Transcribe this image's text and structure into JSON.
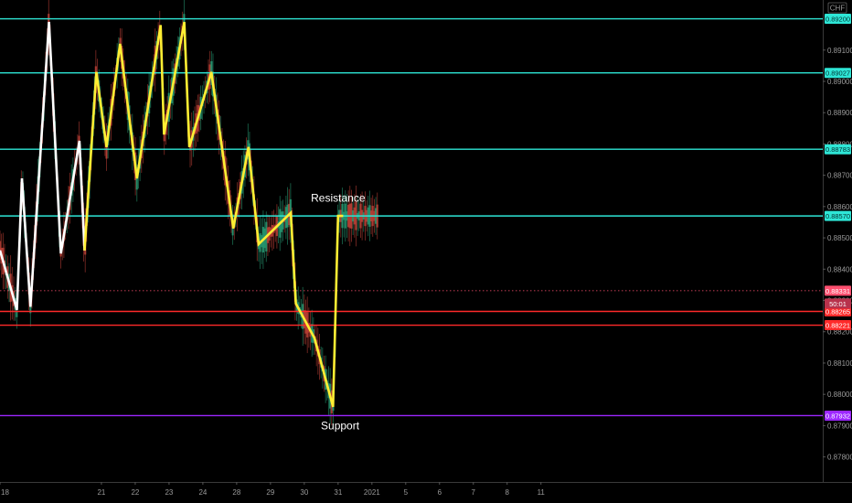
{
  "chart_data": {
    "type": "line",
    "currency": "CHF",
    "y_range": [
      0.8772,
      0.8926
    ],
    "y_ticks": [
      {
        "label": "0.88000",
        "value": 0.88
      },
      {
        "label": "0.88100",
        "value": 0.881
      },
      {
        "label": "0.88200",
        "value": 0.882
      },
      {
        "label": "0.88300",
        "value": 0.883
      },
      {
        "label": "0.88400",
        "value": 0.884
      },
      {
        "label": "0.88500",
        "value": 0.885
      },
      {
        "label": "0.88600",
        "value": 0.886
      },
      {
        "label": "0.88700",
        "value": 0.887
      },
      {
        "label": "0.88800",
        "value": 0.888
      },
      {
        "label": "0.88900",
        "value": 0.889
      },
      {
        "label": "0.89000",
        "value": 0.89
      },
      {
        "label": "0.89100",
        "value": 0.891
      },
      {
        "label": "0.87900",
        "value": 0.879
      },
      {
        "label": "0.87800",
        "value": 0.878
      }
    ],
    "x_range": [
      18,
      43.2
    ],
    "x_ticks": [
      {
        "label": "18",
        "value": 18
      },
      {
        "label": "21",
        "value": 21
      },
      {
        "label": "22",
        "value": 22
      },
      {
        "label": "23",
        "value": 23
      },
      {
        "label": "24",
        "value": 24
      },
      {
        "label": "28",
        "value": 25
      },
      {
        "label": "29",
        "value": 26
      },
      {
        "label": "30",
        "value": 27
      },
      {
        "label": "31",
        "value": 28
      },
      {
        "label": "2021",
        "value": 29
      },
      {
        "label": "5",
        "value": 30
      },
      {
        "label": "6",
        "value": 31
      },
      {
        "label": "7",
        "value": 32
      },
      {
        "label": "8",
        "value": 33
      },
      {
        "label": "11",
        "value": 34
      }
    ],
    "levels": [
      {
        "value": 0.892,
        "label": "0.89200",
        "color": "#2ee6d6"
      },
      {
        "value": 0.89027,
        "label": "0.89027",
        "color": "#2ee6d6"
      },
      {
        "value": 0.88783,
        "label": "0.88783",
        "color": "#2ee6d6"
      },
      {
        "value": 0.8857,
        "label": "0.88570",
        "color": "#2ee6d6"
      },
      {
        "value": 0.88265,
        "label": "0.88265",
        "color": "#ff2a2a"
      },
      {
        "value": 0.88221,
        "label": "0.88221",
        "color": "#ff2a2a"
      },
      {
        "value": 0.87932,
        "label": "0.87932",
        "color": "#9c27ff"
      }
    ],
    "current_price": {
      "value": 0.88331,
      "label": "0.88331",
      "countdown": "50:01",
      "color": "#ff4f6f"
    },
    "series": [
      {
        "color": "#ffffff",
        "points": [
          [
            18.0,
            0.8846
          ],
          [
            18.5,
            0.8827
          ],
          [
            18.65,
            0.8869
          ],
          [
            18.9,
            0.8828
          ],
          [
            19.45,
            0.8919
          ],
          [
            19.8,
            0.8845
          ],
          [
            20.35,
            0.8881
          ],
          [
            20.5,
            0.8846
          ]
        ]
      },
      {
        "color": "#ffee33",
        "points": [
          [
            20.5,
            0.8846
          ],
          [
            20.85,
            0.8903
          ],
          [
            21.15,
            0.8879
          ],
          [
            21.55,
            0.8912
          ],
          [
            22.05,
            0.8869
          ],
          [
            22.75,
            0.8918
          ],
          [
            22.85,
            0.8883
          ],
          [
            23.45,
            0.8919
          ],
          [
            23.6,
            0.8879
          ],
          [
            24.25,
            0.8903
          ],
          [
            24.9,
            0.8853
          ],
          [
            25.35,
            0.8879
          ],
          [
            25.65,
            0.8848
          ],
          [
            26.6,
            0.8858
          ],
          [
            26.75,
            0.8829
          ],
          [
            27.3,
            0.8818
          ],
          [
            27.85,
            0.8796
          ],
          [
            28.0,
            0.8857
          ],
          [
            28.15,
            0.8857
          ]
        ]
      }
    ],
    "annotations": [
      {
        "text": "Resistance",
        "x": 28.0,
        "y": 0.88616
      },
      {
        "text": "Support",
        "x": 28.06,
        "y": 0.87888
      }
    ]
  }
}
